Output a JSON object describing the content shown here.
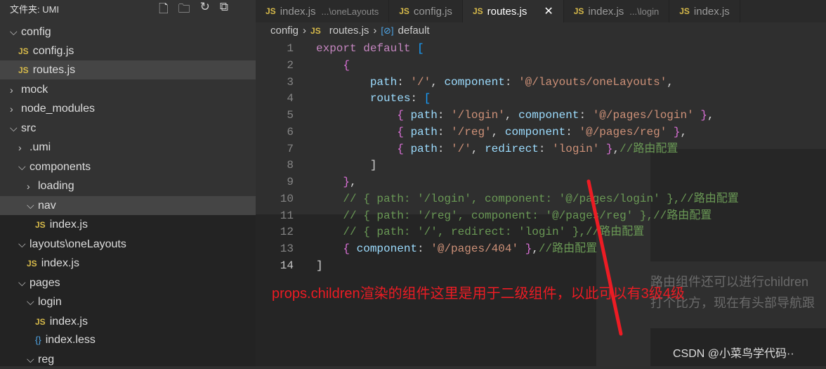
{
  "sidebar": {
    "title": "文件夹: UMI",
    "actions": [
      "new-file",
      "new-folder",
      "refresh",
      "collapse-all"
    ],
    "items": [
      {
        "label": "config",
        "type": "folder",
        "open": true,
        "depth": 0
      },
      {
        "label": "config.js",
        "type": "js",
        "depth": 1
      },
      {
        "label": "routes.js",
        "type": "js",
        "depth": 1,
        "selected": true
      },
      {
        "label": "mock",
        "type": "folder",
        "open": false,
        "depth": 0
      },
      {
        "label": "node_modules",
        "type": "folder",
        "open": false,
        "depth": 0
      },
      {
        "label": "src",
        "type": "folder",
        "open": true,
        "depth": 0
      },
      {
        "label": ".umi",
        "type": "folder",
        "open": false,
        "depth": 1
      },
      {
        "label": "components",
        "type": "folder",
        "open": true,
        "depth": 1
      },
      {
        "label": "loading",
        "type": "folder",
        "open": false,
        "depth": 2
      },
      {
        "label": "nav",
        "type": "folder",
        "open": true,
        "depth": 2,
        "selected": true
      },
      {
        "label": "index.js",
        "type": "js",
        "depth": 3
      },
      {
        "label": "layouts\\oneLayouts",
        "type": "folder",
        "open": true,
        "depth": 1
      },
      {
        "label": "index.js",
        "type": "js",
        "depth": 2
      },
      {
        "label": "pages",
        "type": "folder",
        "open": true,
        "depth": 1
      },
      {
        "label": "login",
        "type": "folder",
        "open": true,
        "depth": 2
      },
      {
        "label": "index.js",
        "type": "js",
        "depth": 3
      },
      {
        "label": "index.less",
        "type": "less",
        "depth": 3
      },
      {
        "label": "reg",
        "type": "folder",
        "open": true,
        "depth": 2
      }
    ]
  },
  "tabs": [
    {
      "label": "index.js",
      "desc": "...\\oneLayouts"
    },
    {
      "label": "config.js",
      "desc": ""
    },
    {
      "label": "routes.js",
      "desc": "",
      "active": true
    },
    {
      "label": "index.js",
      "desc": "...\\login"
    },
    {
      "label": "index.js",
      "desc": ""
    }
  ],
  "breadcrumb": [
    "config",
    "routes.js",
    "default"
  ],
  "code": {
    "current_line": 14,
    "lines": [
      "export default [",
      "    {",
      "        path: '/', component: '@/layouts/oneLayouts',",
      "        routes: [",
      "            { path: '/login', component: '@/pages/login' },",
      "            { path: '/reg', component: '@/pages/reg' },",
      "            { path: '/', redirect: 'login' },//路由配置",
      "        ]",
      "    },",
      "    // { path: '/login', component: '@/pages/login' },//路由配置",
      "    // { path: '/reg', component: '@/pages/reg' },//路由配置",
      "    // { path: '/', redirect: 'login' },//路由配置",
      "    { component: '@/pages/404' },//路由配置",
      "]"
    ]
  },
  "annotation": "props.children渲染的组件这里是用于二级组件，以此可以有3级4级",
  "background": {
    "text1": "路由组件还可以进行children",
    "text2": "打个比方，现在有头部导航跟"
  },
  "watermark": "CSDN @小菜鸟学代码··",
  "colors": {
    "annotation": "#ec1c24",
    "keyword": "#c586c0",
    "string": "#ce9178",
    "comment": "#6a9955",
    "property": "#9cdcfe"
  }
}
